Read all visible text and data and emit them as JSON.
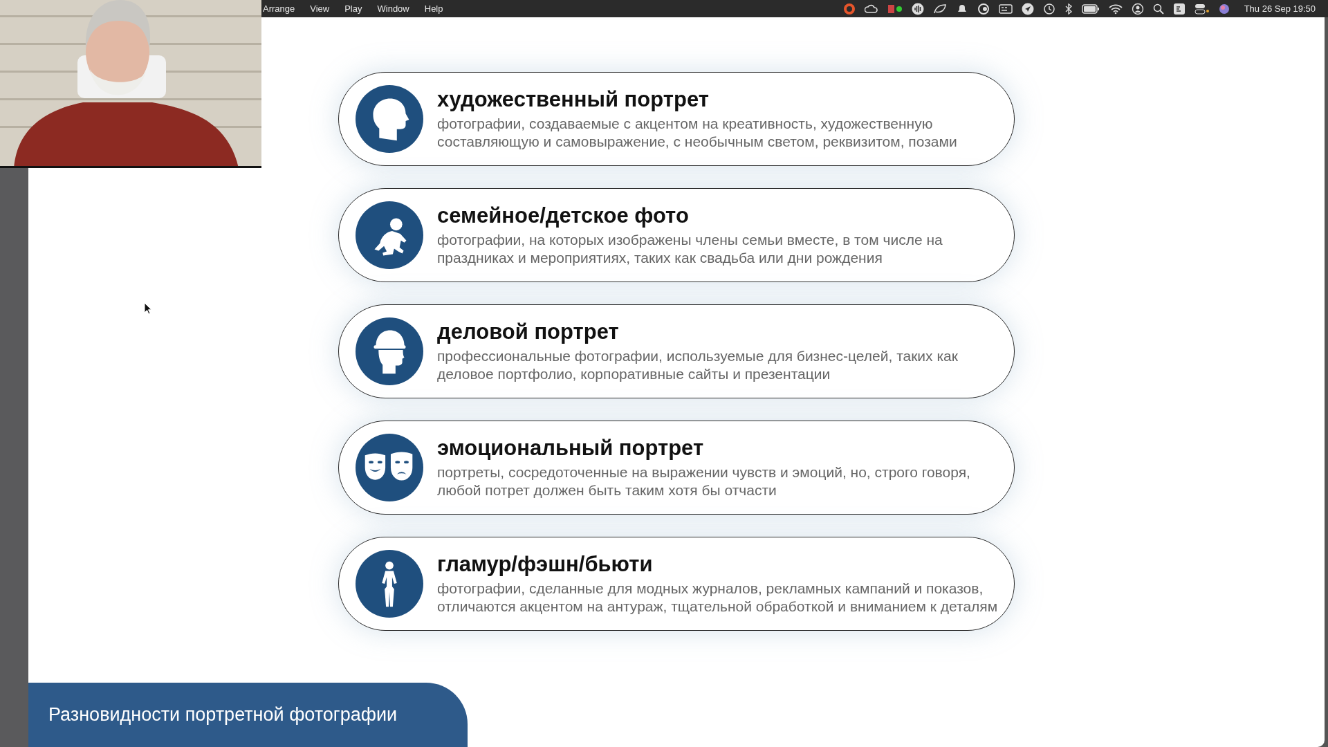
{
  "menu_bar": {
    "menus": [
      "Arrange",
      "View",
      "Play",
      "Window",
      "Help"
    ],
    "clock": "Thu 26 Sep 19:50"
  },
  "slide": {
    "cards": [
      {
        "kind": "head",
        "title": "художественный портрет",
        "description": "фотографии, создаваемые с акцентом на креативность, художественную составляющую и самовыражение, с необычным светом, реквизитом, позами"
      },
      {
        "kind": "baby",
        "title": "семейное/детское фото",
        "description": "фотографии, на которых изображены члены семьи вместе, в том числе на праздниках и мероприятиях, таких как свадьба или дни рождения"
      },
      {
        "kind": "helmet",
        "title": "деловой портрет",
        "description": "профессиональные фотографии, используемые для бизнес-целей, таких как деловое портфолио, корпоративные сайты и презентации"
      },
      {
        "kind": "masks",
        "title": "эмоциональный портрет",
        "description": "портреты, сосредоточенные на выражении чувств и эмоций, но, строго говоря, любой потрет должен быть таким хотя бы отчасти"
      },
      {
        "kind": "figure",
        "title": "гламур/фэшн/бьюти",
        "description": "фотографии, сделанные для модных журналов, рекламных кампаний и показов, отличаются акцентом на антураж, тщательной обработкой и вниманием к деталям"
      }
    ],
    "footer_title": "Разновидности портретной фотографии"
  }
}
